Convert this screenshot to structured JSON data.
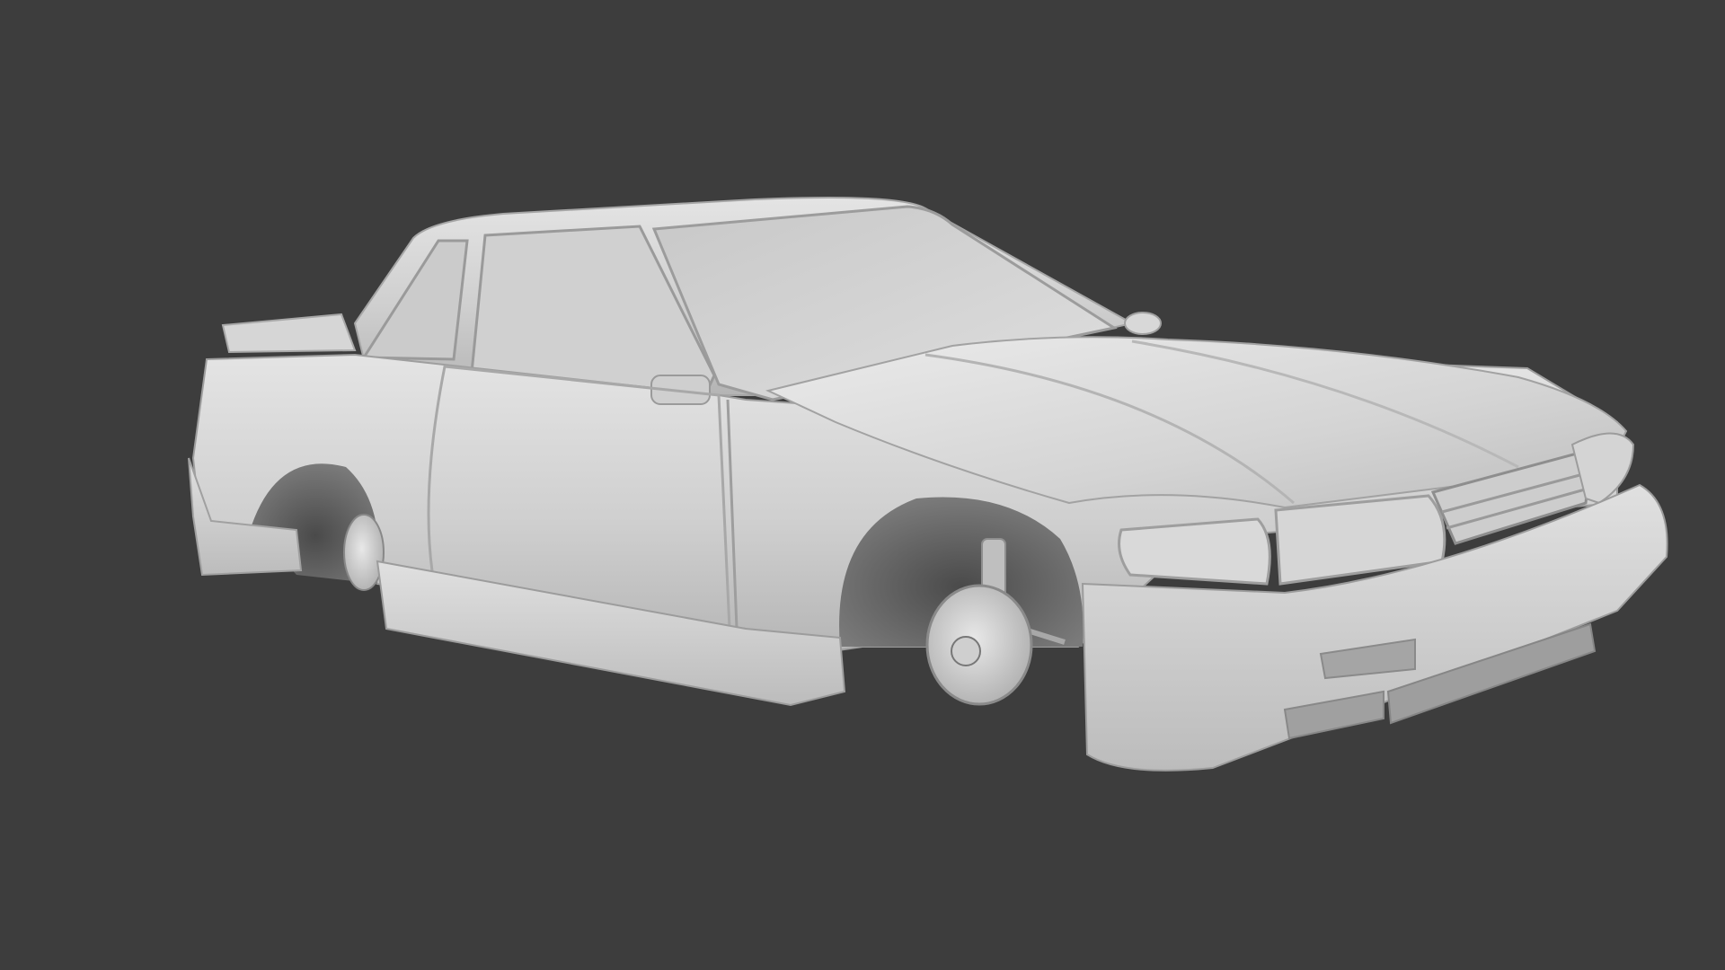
{
  "scene": {
    "subject": "car-body-model",
    "render_style": "clay",
    "colors": {
      "background": "#3d3d3d",
      "clay_light": "#e2e2e2",
      "clay_mid": "#c6c6c6",
      "clay_dark": "#8e8e8e",
      "shadow": "#2a2a2a"
    }
  }
}
